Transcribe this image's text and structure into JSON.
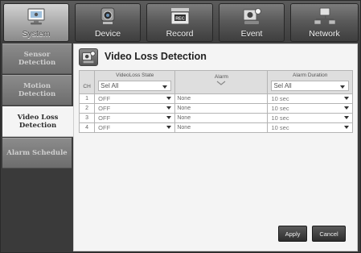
{
  "top_tabs": [
    {
      "label": "System",
      "icon": "monitor-icon",
      "active": true
    },
    {
      "label": "Device",
      "icon": "camera-icon",
      "active": false
    },
    {
      "label": "Record",
      "icon": "rec-icon",
      "active": false
    },
    {
      "label": "Event",
      "icon": "event-icon",
      "active": false
    },
    {
      "label": "Network",
      "icon": "network-icon",
      "active": false
    }
  ],
  "sidebar": {
    "items": [
      {
        "label": "Sensor Detection",
        "active": false
      },
      {
        "label": "Motion Detection",
        "active": false
      },
      {
        "label": "Video Loss Detection",
        "active": true
      },
      {
        "label": "Alarm Schedule",
        "active": false
      }
    ]
  },
  "panel": {
    "title": "Video Loss Detection",
    "icon": "video-loss-icon"
  },
  "table": {
    "headers": {
      "ch": "CH",
      "state": "VideoLoss State",
      "alarm": "Alarm",
      "duration": "Alarm Duration"
    },
    "header_selects": {
      "state": "Sel All",
      "duration": "Sel All"
    },
    "rows": [
      {
        "ch": "1",
        "state": "OFF",
        "alarm": "None",
        "duration": "10 sec"
      },
      {
        "ch": "2",
        "state": "OFF",
        "alarm": "None",
        "duration": "10 sec"
      },
      {
        "ch": "3",
        "state": "OFF",
        "alarm": "None",
        "duration": "10 sec"
      },
      {
        "ch": "4",
        "state": "OFF",
        "alarm": "None",
        "duration": "10 sec"
      }
    ]
  },
  "buttons": {
    "apply": "Apply",
    "cancel": "Cancel"
  },
  "colors": {
    "frame": "#3a3a3a",
    "panel_bg": "#f4f4f4",
    "active_tab": "#bdbdbd",
    "button": "#3a3a3a"
  }
}
